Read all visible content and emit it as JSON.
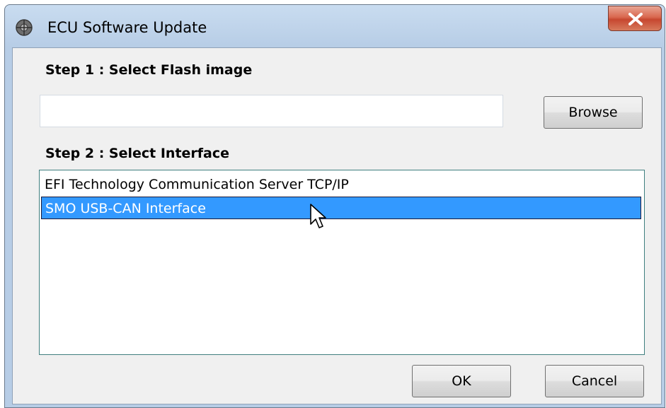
{
  "window": {
    "title": "ECU Software Update"
  },
  "step1": {
    "label": "Step  1 :  Select Flash image",
    "path_value": "",
    "browse_label": "Browse"
  },
  "step2": {
    "label": "Step  2 :  Select Interface",
    "interfaces": [
      {
        "label": "EFI Technology Communication Server TCP/IP",
        "selected": false
      },
      {
        "label": "SMO USB-CAN Interface",
        "selected": true
      }
    ]
  },
  "footer": {
    "ok_label": "OK",
    "cancel_label": "Cancel"
  },
  "colors": {
    "selection": "#3399ff",
    "close_button": "#c74730",
    "dialog_bg": "#f0f0f0"
  },
  "icons": {
    "app": "gear-globe-icon",
    "close": "close-icon",
    "cursor": "mouse-pointer-icon"
  }
}
